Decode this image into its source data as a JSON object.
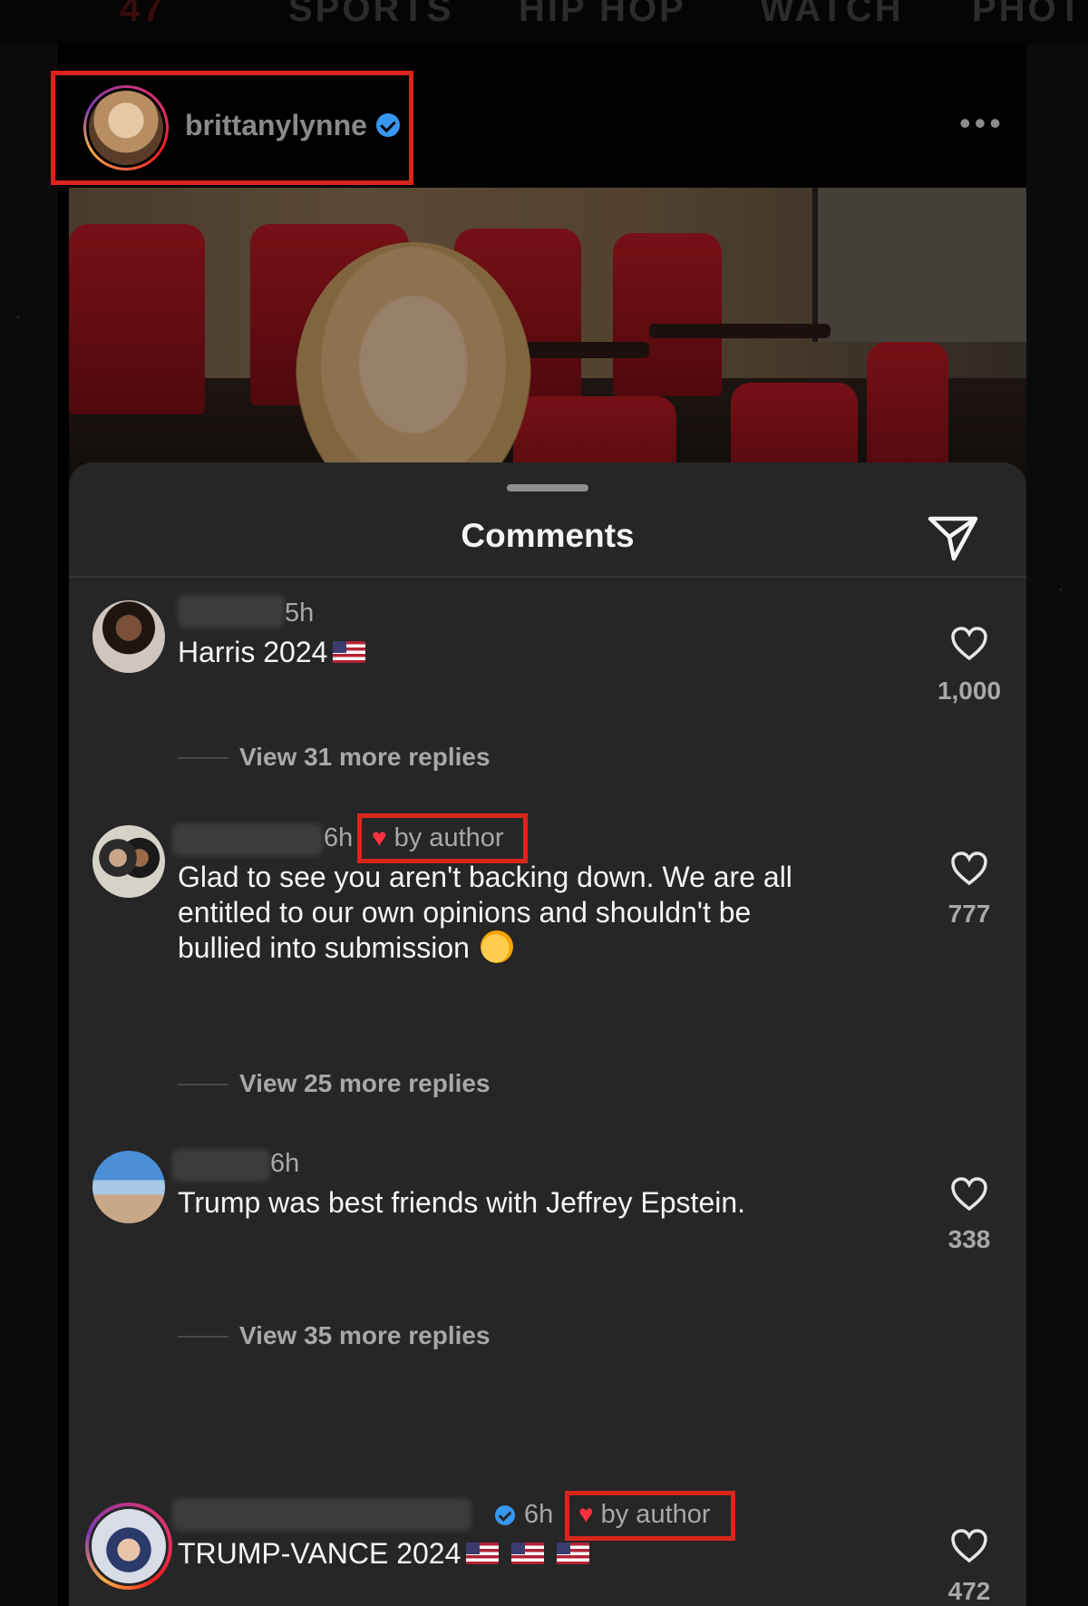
{
  "site_nav": {
    "items": [
      "47",
      "SPORTS",
      "HIP HOP",
      "WATCH",
      "PHOT"
    ]
  },
  "post": {
    "username": "brittanylynne",
    "verified": true,
    "more_icon": "ellipsis-icon"
  },
  "comments_sheet": {
    "title": "Comments",
    "send_icon": "paper-plane-icon",
    "comments": [
      {
        "time": "5h",
        "text": "Harris 2024",
        "likes": "1,000",
        "replies_label": "View 31 more replies",
        "liked_by_author": false
      },
      {
        "time": "6h",
        "by_author": "by author",
        "text": "Glad to see you aren't backing down. We are all entitled to our own opinions and shouldn't be bullied into submission",
        "likes": "777",
        "replies_label": "View 25 more replies",
        "liked_by_author": true
      },
      {
        "time": "6h",
        "text": "Trump was best friends with Jeffrey Epstein.",
        "likes": "338",
        "replies_label": "View 35 more replies",
        "liked_by_author": false
      },
      {
        "time": "6h",
        "by_author": "by author",
        "text": "TRUMP-VANCE 2024",
        "likes": "472",
        "liked_by_author": true,
        "verified": true
      }
    ]
  },
  "colors": {
    "highlight_box": "#d9261c",
    "heart": "#ff3040",
    "verified": "#3897f0",
    "sheet_bg": "#262626"
  }
}
